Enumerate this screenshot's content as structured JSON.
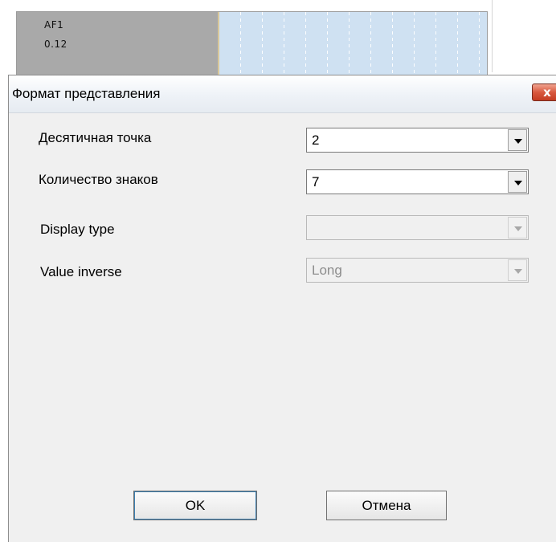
{
  "background_widget": {
    "title": "AF1",
    "value": "0.12"
  },
  "dialog": {
    "title": "Формат представления",
    "close_label": "x",
    "fields": [
      {
        "label": "Десятичная точка",
        "value": "2",
        "enabled": true
      },
      {
        "label": "Количество знаков",
        "value": "7",
        "enabled": true
      },
      {
        "label": "Display type",
        "value": "",
        "enabled": false
      },
      {
        "label": "Value inverse",
        "value": "Long",
        "enabled": false
      }
    ],
    "buttons": {
      "ok_label": "OK",
      "cancel_label": "Отмена"
    }
  },
  "colors": {
    "close_button": "#d8583e",
    "widget_grid": "#cfe1f2",
    "widget_label_bg": "#a9a9a9"
  }
}
